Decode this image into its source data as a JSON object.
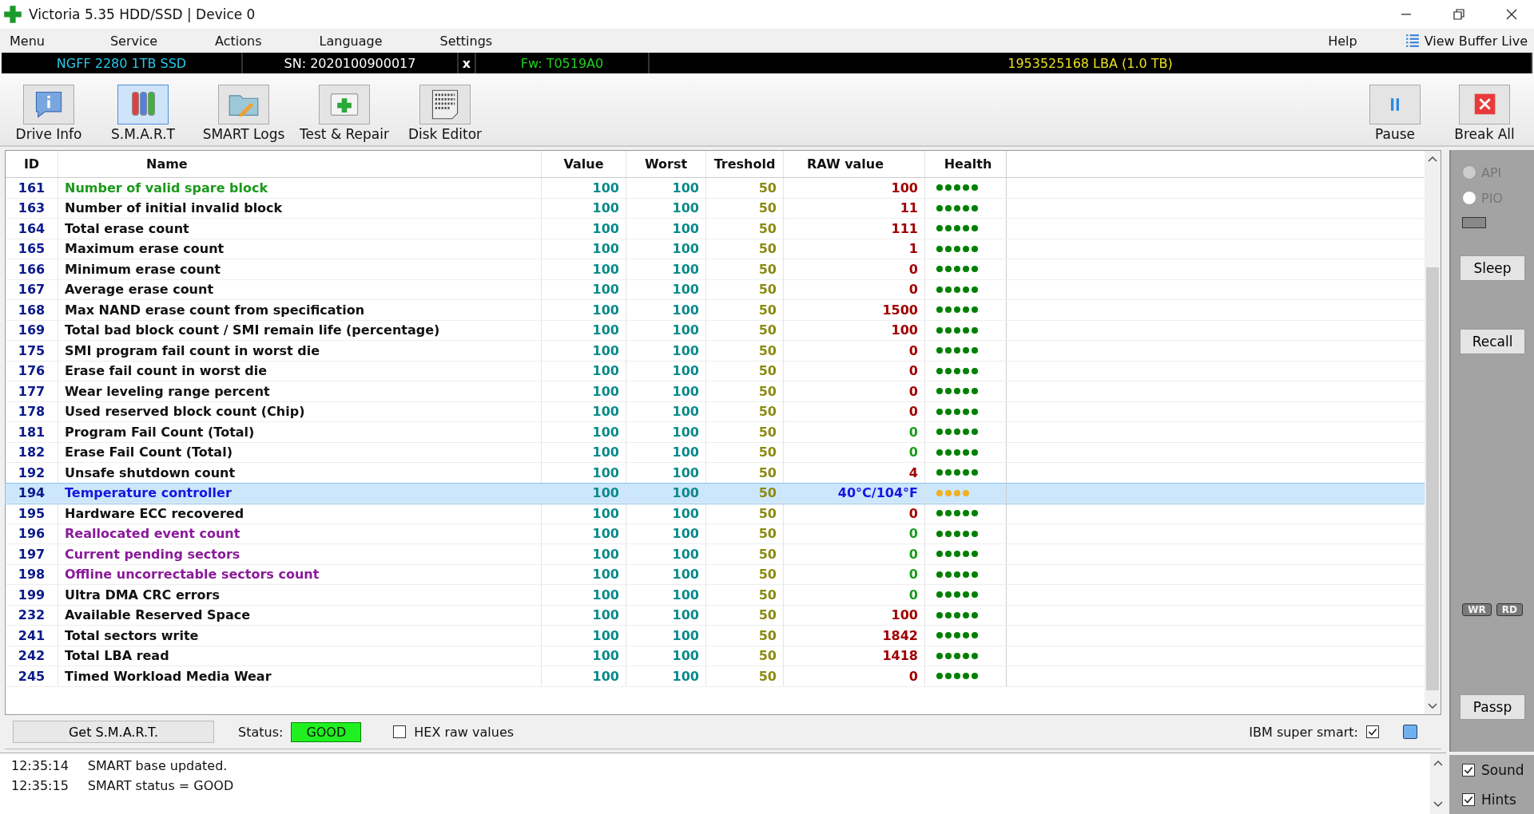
{
  "window": {
    "title": "Victoria 5.35 HDD/SSD | Device 0"
  },
  "menu": {
    "items": [
      "Menu",
      "Service",
      "Actions",
      "Language",
      "Settings"
    ],
    "help": "Help",
    "view_buffer": "View Buffer Live"
  },
  "drive_bar": {
    "model": "NGFF 2280 1TB SSD",
    "serial": "SN: 2020100900017",
    "close": "x",
    "firmware": "Fw: T0519A0",
    "capacity": "1953525168 LBA (1.0 TB)"
  },
  "toolbar": {
    "tools": [
      {
        "label": "Drive Info",
        "kind": "info",
        "selected": false
      },
      {
        "label": "S.M.A.R.T",
        "kind": "smart",
        "selected": true
      },
      {
        "label": "SMART Logs",
        "kind": "logs",
        "selected": false
      },
      {
        "label": "Test & Repair",
        "kind": "repair",
        "selected": false
      },
      {
        "label": "Disk Editor",
        "kind": "editor",
        "selected": false
      }
    ],
    "actions": [
      {
        "label": "Pause",
        "kind": "pause"
      },
      {
        "label": "Break All",
        "kind": "break"
      }
    ]
  },
  "table": {
    "columns": [
      "ID",
      "Name",
      "Value",
      "Worst",
      "Treshold",
      "RAW value",
      "Health"
    ],
    "rows": [
      {
        "id": "161",
        "name": "Number of valid spare block",
        "value": "100",
        "worst": "100",
        "threshold": "50",
        "raw": "100",
        "kind": "counter",
        "health": {
          "kind": "good",
          "stars": 5
        },
        "color": "#1a9a1a",
        "selected": false
      },
      {
        "id": "163",
        "name": "Number of initial invalid block",
        "value": "100",
        "worst": "100",
        "threshold": "50",
        "raw": "11",
        "kind": "counter",
        "health": {
          "kind": "good",
          "stars": 5
        },
        "color": "#111111",
        "selected": false
      },
      {
        "id": "164",
        "name": "Total erase count",
        "value": "100",
        "worst": "100",
        "threshold": "50",
        "raw": "111",
        "kind": "counter",
        "health": {
          "kind": "good",
          "stars": 5
        },
        "color": "#111111",
        "selected": false
      },
      {
        "id": "165",
        "name": "Maximum erase count",
        "value": "100",
        "worst": "100",
        "threshold": "50",
        "raw": "1",
        "kind": "counter",
        "health": {
          "kind": "good",
          "stars": 5
        },
        "color": "#111111",
        "selected": false
      },
      {
        "id": "166",
        "name": "Minimum erase count",
        "value": "100",
        "worst": "100",
        "threshold": "50",
        "raw": "0",
        "kind": "counter",
        "health": {
          "kind": "good",
          "stars": 5
        },
        "color": "#111111",
        "selected": false
      },
      {
        "id": "167",
        "name": "Average erase count",
        "value": "100",
        "worst": "100",
        "threshold": "50",
        "raw": "0",
        "kind": "counter",
        "health": {
          "kind": "good",
          "stars": 5
        },
        "color": "#111111",
        "selected": false
      },
      {
        "id": "168",
        "name": "Max NAND erase count from specification",
        "value": "100",
        "worst": "100",
        "threshold": "50",
        "raw": "1500",
        "kind": "counter",
        "health": {
          "kind": "good",
          "stars": 5
        },
        "color": "#111111",
        "selected": false
      },
      {
        "id": "169",
        "name": "Total bad block count / SMI remain life (percentage)",
        "value": "100",
        "worst": "100",
        "threshold": "50",
        "raw": "100",
        "kind": "counter",
        "health": {
          "kind": "good",
          "stars": 5
        },
        "color": "#111111",
        "selected": false
      },
      {
        "id": "175",
        "name": "SMI program fail count in worst die",
        "value": "100",
        "worst": "100",
        "threshold": "50",
        "raw": "0",
        "kind": "counter",
        "health": {
          "kind": "good",
          "stars": 5
        },
        "color": "#111111",
        "selected": false
      },
      {
        "id": "176",
        "name": "Erase fail count in worst die",
        "value": "100",
        "worst": "100",
        "threshold": "50",
        "raw": "0",
        "kind": "counter",
        "health": {
          "kind": "good",
          "stars": 5
        },
        "color": "#111111",
        "selected": false
      },
      {
        "id": "177",
        "name": "Wear leveling range percent",
        "value": "100",
        "worst": "100",
        "threshold": "50",
        "raw": "0",
        "kind": "counter",
        "health": {
          "kind": "good",
          "stars": 5
        },
        "color": "#111111",
        "selected": false
      },
      {
        "id": "178",
        "name": "Used reserved block count (Chip)",
        "value": "100",
        "worst": "100",
        "threshold": "50",
        "raw": "0",
        "kind": "counter",
        "health": {
          "kind": "good",
          "stars": 5
        },
        "color": "#111111",
        "selected": false
      },
      {
        "id": "181",
        "name": "Program Fail Count (Total)",
        "value": "100",
        "worst": "100",
        "threshold": "50",
        "raw": "0",
        "kind": "error",
        "health": {
          "kind": "good",
          "stars": 5
        },
        "color": "#111111",
        "selected": false
      },
      {
        "id": "182",
        "name": "Erase Fail Count (Total)",
        "value": "100",
        "worst": "100",
        "threshold": "50",
        "raw": "0",
        "kind": "error",
        "health": {
          "kind": "good",
          "stars": 5
        },
        "color": "#111111",
        "selected": false
      },
      {
        "id": "192",
        "name": "Unsafe shutdown count",
        "value": "100",
        "worst": "100",
        "threshold": "50",
        "raw": "4",
        "kind": "counter",
        "health": {
          "kind": "good",
          "stars": 5
        },
        "color": "#111111",
        "selected": false
      },
      {
        "id": "194",
        "name": "Temperature controller",
        "value": "100",
        "worst": "100",
        "threshold": "50",
        "raw": "40°C/104°F",
        "kind": "temperature",
        "health": {
          "kind": "fair",
          "stars": 4
        },
        "color": "#1515e0",
        "selected": true
      },
      {
        "id": "195",
        "name": "Hardware ECC recovered",
        "value": "100",
        "worst": "100",
        "threshold": "50",
        "raw": "0",
        "kind": "counter",
        "health": {
          "kind": "good",
          "stars": 5
        },
        "color": "#111111",
        "selected": false
      },
      {
        "id": "196",
        "name": "Reallocated event count",
        "value": "100",
        "worst": "100",
        "threshold": "50",
        "raw": "0",
        "kind": "error",
        "health": {
          "kind": "good",
          "stars": 5
        },
        "color": "#8a1a9a",
        "selected": false
      },
      {
        "id": "197",
        "name": "Current pending sectors",
        "value": "100",
        "worst": "100",
        "threshold": "50",
        "raw": "0",
        "kind": "error",
        "health": {
          "kind": "good",
          "stars": 5
        },
        "color": "#8a1a9a",
        "selected": false
      },
      {
        "id": "198",
        "name": "Offline uncorrectable sectors count",
        "value": "100",
        "worst": "100",
        "threshold": "50",
        "raw": "0",
        "kind": "error",
        "health": {
          "kind": "good",
          "stars": 5
        },
        "color": "#8a1a9a",
        "selected": false
      },
      {
        "id": "199",
        "name": "Ultra DMA CRC errors",
        "value": "100",
        "worst": "100",
        "threshold": "50",
        "raw": "0",
        "kind": "error",
        "health": {
          "kind": "good",
          "stars": 5
        },
        "color": "#111111",
        "selected": false
      },
      {
        "id": "232",
        "name": "Available Reserved Space",
        "value": "100",
        "worst": "100",
        "threshold": "50",
        "raw": "100",
        "kind": "counter",
        "health": {
          "kind": "good",
          "stars": 5
        },
        "color": "#111111",
        "selected": false
      },
      {
        "id": "241",
        "name": "Total sectors write",
        "value": "100",
        "worst": "100",
        "threshold": "50",
        "raw": "1842",
        "kind": "counter",
        "health": {
          "kind": "good",
          "stars": 5
        },
        "color": "#111111",
        "selected": false
      },
      {
        "id": "242",
        "name": "Total LBA read",
        "value": "100",
        "worst": "100",
        "threshold": "50",
        "raw": "1418",
        "kind": "counter",
        "health": {
          "kind": "good",
          "stars": 5
        },
        "color": "#111111",
        "selected": false
      },
      {
        "id": "245",
        "name": "Timed Workload Media Wear",
        "value": "100",
        "worst": "100",
        "threshold": "50",
        "raw": "0",
        "kind": "counter",
        "health": {
          "kind": "good",
          "stars": 5
        },
        "color": "#111111",
        "selected": false
      }
    ]
  },
  "bottom_bar": {
    "get_button": "Get S.M.A.R.T.",
    "status_label": "Status:",
    "status_value": "GOOD",
    "hex": {
      "label": "HEX raw values",
      "checked": false
    },
    "ibm": {
      "label": "IBM super smart:",
      "checked": true
    }
  },
  "log": [
    {
      "time": "12:35:14",
      "message": "SMART base updated."
    },
    {
      "time": "12:35:15",
      "message": "SMART status = GOOD"
    }
  ],
  "side_panel": {
    "radios": [
      {
        "label": "API",
        "selected": false,
        "disabled": true
      },
      {
        "label": "PIO",
        "selected": false,
        "disabled": false
      }
    ],
    "sleep": "Sleep",
    "recall": "Recall",
    "wr": "WR",
    "rd": "RD",
    "passp": "Passp",
    "checks": [
      {
        "label": "Sound",
        "checked": true
      },
      {
        "label": "Hints",
        "checked": true
      }
    ]
  }
}
